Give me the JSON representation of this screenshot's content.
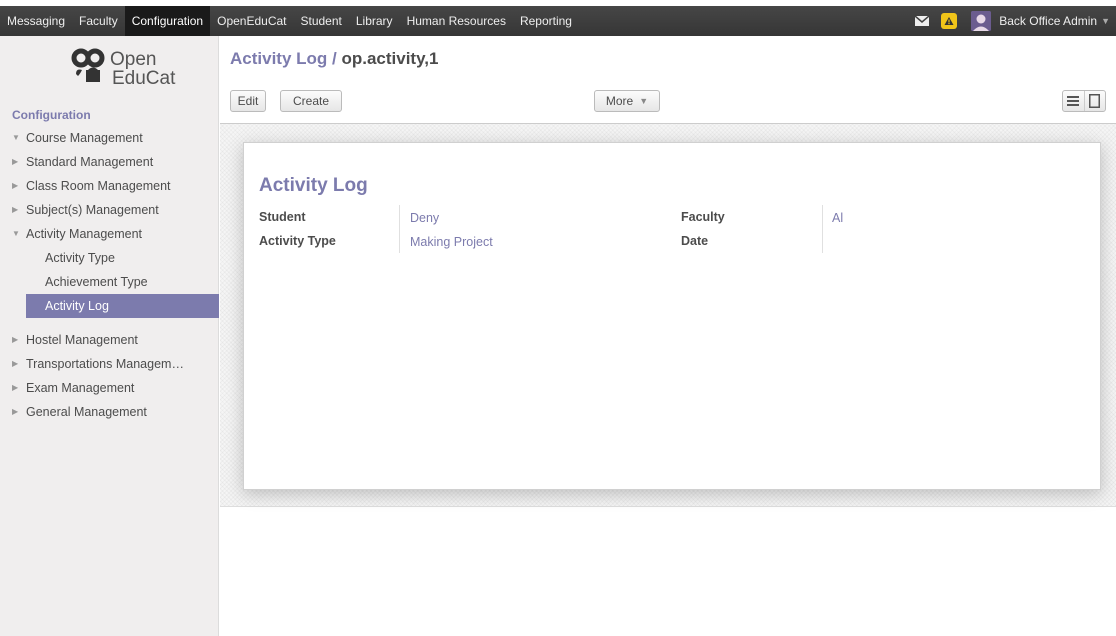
{
  "topbar": {
    "menu": [
      {
        "label": "Messaging",
        "active": false
      },
      {
        "label": "Faculty",
        "active": false
      },
      {
        "label": "Configuration",
        "active": true
      },
      {
        "label": "OpenEduCat",
        "active": false
      },
      {
        "label": "Student",
        "active": false
      },
      {
        "label": "Library",
        "active": false
      },
      {
        "label": "Human Resources",
        "active": false
      },
      {
        "label": "Reporting",
        "active": false
      }
    ],
    "user_name": "Back Office Admin",
    "icons": [
      "mail-icon",
      "warning-icon",
      "avatar"
    ]
  },
  "logo": {
    "line1": "Open",
    "line2": "EduCat"
  },
  "sidebar": {
    "heading": "Configuration",
    "items": [
      {
        "label": "Course Management",
        "expanded": true
      },
      {
        "label": "Standard Management",
        "expanded": false
      },
      {
        "label": "Class Room Management",
        "expanded": false
      },
      {
        "label": "Subject(s) Management",
        "expanded": false
      },
      {
        "label": "Activity Management",
        "expanded": true
      },
      {
        "label": "Activity Type"
      },
      {
        "label": "Achievement Type"
      },
      {
        "label": "Activity Log",
        "active": true
      },
      {
        "label": "Hostel Management",
        "expanded": false
      },
      {
        "label": "Transportations Managem…",
        "expanded": false
      },
      {
        "label": "Exam Management",
        "expanded": false
      },
      {
        "label": "General Management",
        "expanded": false
      }
    ]
  },
  "breadcrumb": {
    "parent": "Activity Log",
    "separator": " / ",
    "current": "op.activity,1"
  },
  "toolbar": {
    "edit_label": "Edit",
    "create_label": "Create",
    "more_label": "More"
  },
  "form": {
    "title": "Activity Log",
    "fields": {
      "student": {
        "label": "Student",
        "value": "Deny"
      },
      "activity_type": {
        "label": "Activity Type",
        "value": "Making Project"
      },
      "faculty": {
        "label": "Faculty",
        "value": "Al"
      },
      "date": {
        "label": "Date",
        "value": ""
      }
    }
  },
  "colors": {
    "accent": "#7c7bad",
    "topbar": "#404040",
    "sidebar": "#f0eeee"
  }
}
